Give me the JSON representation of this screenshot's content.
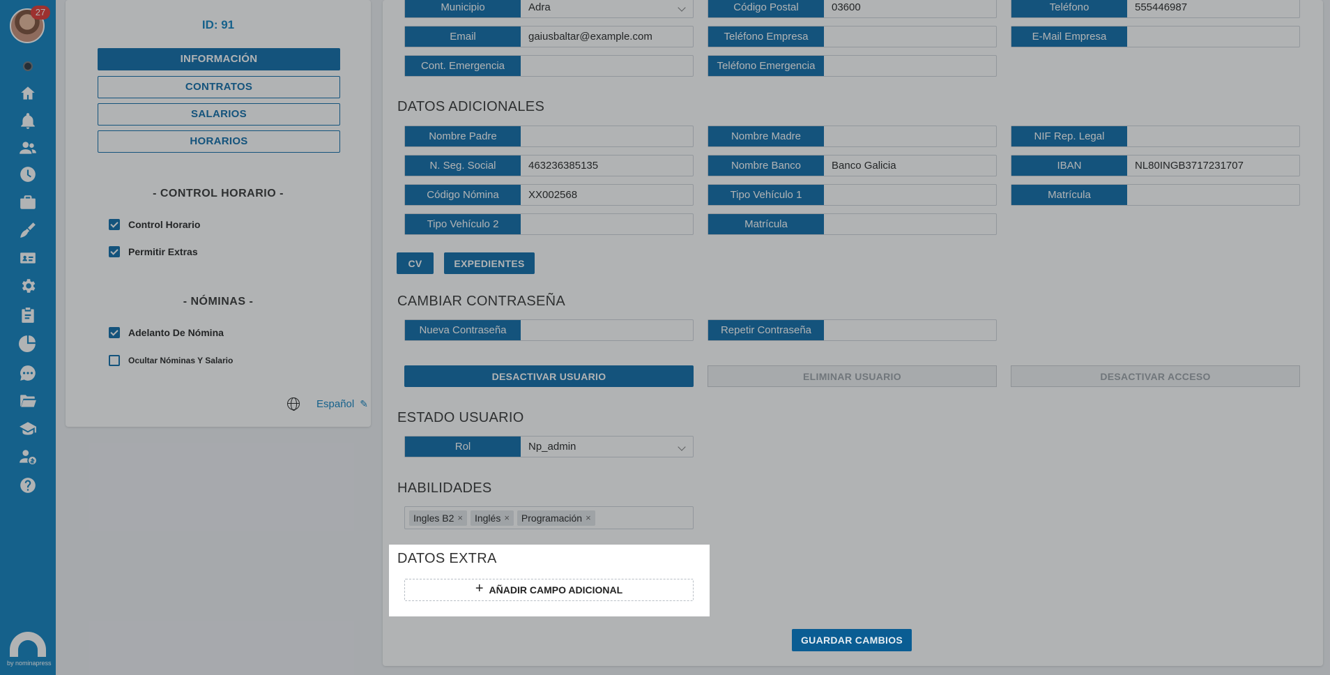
{
  "sidebar": {
    "notification_count": "27",
    "icons": [
      "home-icon",
      "bell-icon",
      "users-icon",
      "clock-icon",
      "briefcase-icon",
      "broom-icon",
      "id-card-icon",
      "gear-icon",
      "clipboard-icon",
      "pie-chart-icon",
      "chat-icon",
      "folder-icon",
      "graduation-cap-icon",
      "user-money-icon",
      "help-icon"
    ],
    "brand_text": "by nominapress"
  },
  "left_panel": {
    "id_text": "ID: 91",
    "nav": [
      "INFORMACIÓN",
      "CONTRATOS",
      "SALARIOS",
      "HORARIOS"
    ],
    "control_title": "- CONTROL HORARIO -",
    "control_items": [
      {
        "label": "Control Horario",
        "checked": true
      },
      {
        "label": "Permitir Extras",
        "checked": true
      }
    ],
    "nominas_title": "- NÓMINAS -",
    "nominas_items": [
      {
        "label": "Adelanto De Nómina",
        "checked": true
      },
      {
        "label": "Ocultar Nóminas Y Salario",
        "checked": false
      }
    ],
    "language": "Español"
  },
  "contact": {
    "rows": [
      [
        {
          "label": "Municipio",
          "value": "Adra",
          "select": true
        },
        {
          "label": "Código Postal",
          "value": "03600"
        },
        {
          "label": "Teléfono",
          "value": "555446987"
        }
      ],
      [
        {
          "label": "Email",
          "value": "gaiusbaltar@example.com"
        },
        {
          "label": "Teléfono Empresa",
          "value": ""
        },
        {
          "label": "E-Mail Empresa",
          "value": ""
        }
      ],
      [
        {
          "label": "Cont. Emergencia",
          "value": ""
        },
        {
          "label": "Teléfono Emergencia",
          "value": ""
        }
      ]
    ]
  },
  "datos_adicionales": {
    "title": "DATOS ADICIONALES",
    "rows": [
      [
        {
          "label": "Nombre Padre",
          "value": ""
        },
        {
          "label": "Nombre Madre",
          "value": ""
        },
        {
          "label": "NIF Rep. Legal",
          "value": ""
        }
      ],
      [
        {
          "label": "N. Seg. Social",
          "value": "463236385135"
        },
        {
          "label": "Nombre Banco",
          "value": "Banco Galicia"
        },
        {
          "label": "IBAN",
          "value": "NL80INGB3717231707"
        }
      ],
      [
        {
          "label": "Código Nómina",
          "value": "XX002568"
        },
        {
          "label": "Tipo Vehículo 1",
          "value": ""
        },
        {
          "label": "Matrícula",
          "value": ""
        }
      ],
      [
        {
          "label": "Tipo Vehículo 2",
          "value": ""
        },
        {
          "label": "Matrícula",
          "value": ""
        }
      ]
    ],
    "cv_label": "CV",
    "expedientes_label": "EXPEDIENTES"
  },
  "cambiar_contrasena": {
    "title": "CAMBIAR CONTRASEÑA",
    "nueva_label": "Nueva Contraseña",
    "repetir_label": "Repetir Contraseña",
    "desactivar_usuario": "DESACTIVAR USUARIO",
    "eliminar_usuario": "ELIMINAR USUARIO",
    "desactivar_acceso": "DESACTIVAR ACCESO"
  },
  "estado_usuario": {
    "title": "ESTADO USUARIO",
    "rol_label": "Rol",
    "rol_value": "Np_admin"
  },
  "habilidades": {
    "title": "HABILIDADES",
    "chips": [
      "Ingles B2",
      "Inglés",
      "Programación"
    ]
  },
  "datos_extra": {
    "title": "DATOS EXTRA",
    "add_label": "AÑADIR CAMPO ADICIONAL"
  },
  "save_label": "GUARDAR CAMBIOS"
}
